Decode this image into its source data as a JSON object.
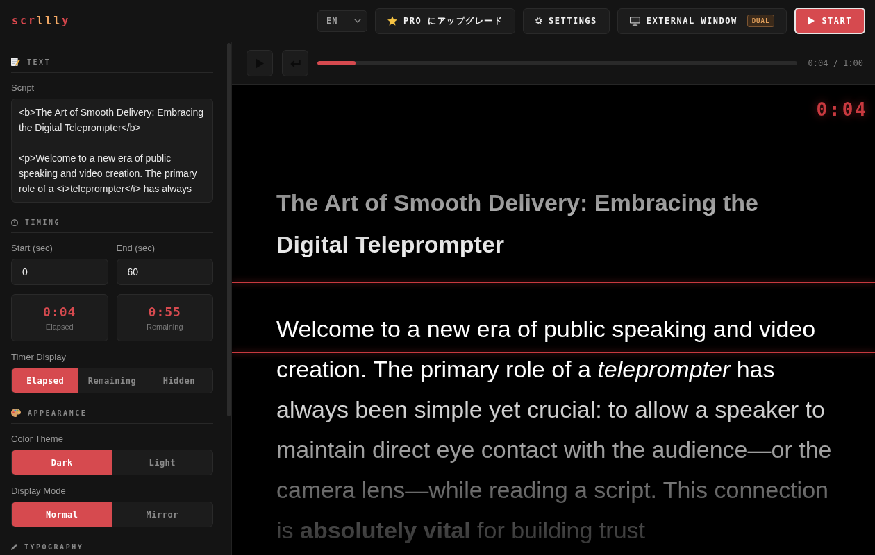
{
  "header": {
    "logo": "scrllly",
    "language_select": {
      "value": "EN"
    },
    "buttons": [
      {
        "kind": "upgrade",
        "label": "PRO にアップグレード"
      },
      {
        "kind": "settings",
        "label": "SETTINGS"
      },
      {
        "kind": "external_window",
        "label": "EXTERNAL WINDOW",
        "badge": "DUAL"
      },
      {
        "kind": "start",
        "label": "START"
      }
    ]
  },
  "sidebar": {
    "sections": [
      {
        "kind": "text",
        "heading": "TEXT",
        "controls": [
          {
            "kind": "textarea",
            "label": "Script",
            "value": "<b>The Art of Smooth Delivery: Embracing the Digital Teleprompter</b>\n\n<p>Welcome to a new era of public speaking and video creation. The primary role of a <i>teleprompter</i> has always"
          }
        ]
      },
      {
        "kind": "timing",
        "heading": "TIMING",
        "controls": [
          {
            "kind": "inputs",
            "fields": [
              {
                "label": "Start (sec)",
                "value": "0"
              },
              {
                "label": "End (sec)",
                "value": "60"
              }
            ]
          },
          {
            "kind": "stats",
            "items": [
              {
                "value": "0:04",
                "label": "Elapsed"
              },
              {
                "value": "0:55",
                "label": "Remaining"
              }
            ]
          },
          {
            "kind": "segmented",
            "label": "Timer Display",
            "options": [
              {
                "label": "Elapsed",
                "selected": true
              },
              {
                "label": "Remaining",
                "selected": false
              },
              {
                "label": "Hidden",
                "selected": false
              }
            ]
          }
        ]
      },
      {
        "kind": "appearance",
        "heading": "APPEARANCE",
        "controls": [
          {
            "kind": "segmented",
            "label": "Color Theme",
            "options": [
              {
                "label": "Dark",
                "selected": true
              },
              {
                "label": "Light",
                "selected": false
              }
            ]
          },
          {
            "kind": "segmented",
            "label": "Display Mode",
            "options": [
              {
                "label": "Normal",
                "selected": true
              },
              {
                "label": "Mirror",
                "selected": false
              }
            ]
          }
        ]
      },
      {
        "kind": "typography",
        "heading": "TYPOGRAPHY"
      }
    ]
  },
  "player": {
    "progress": {
      "level": 0.08
    },
    "time": "0:04 / 1:00"
  },
  "prompter": {
    "timer": "0:04",
    "title": "The Art of Smooth Delivery: Embracing the Digital Teleprompter",
    "paragraph": "Welcome to a new era of public speaking and video creation. The primary role of a *teleprompter* has always been simple yet crucial: to allow a speaker to maintain direct eye contact with the audience—or the camera lens—while reading a script. This connection is **absolutely vital** for building trust"
  }
}
